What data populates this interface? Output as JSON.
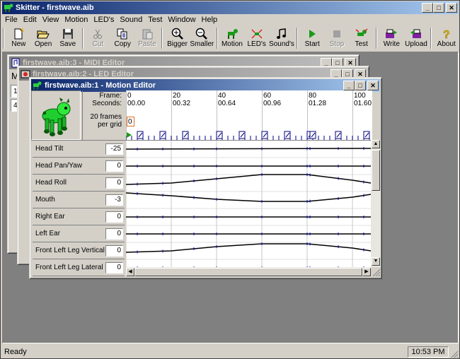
{
  "app": {
    "title": "Skitter - firstwave.aib"
  },
  "menu": [
    "File",
    "Edit",
    "View",
    "Motion",
    "LED's",
    "Sound",
    "Test",
    "Window",
    "Help"
  ],
  "toolbar": {
    "new": "New",
    "open": "Open",
    "save": "Save",
    "cut": "Cut",
    "copy": "Copy",
    "paste": "Paste",
    "bigger": "Bigger",
    "smaller": "Smaller",
    "motion": "Motion",
    "leds": "LED's",
    "sounds": "Sound's",
    "start": "Start",
    "stop": "Stop",
    "test": "Test",
    "write": "Write",
    "upload": "Upload",
    "about": "About"
  },
  "windows": {
    "midi": {
      "title": "firstwave.aib:3 - MIDI Editor",
      "partial": "M",
      "fields": [
        "1",
        "4"
      ]
    },
    "led": {
      "title": "firstwave.aib:2 - LED Editor"
    },
    "motion": {
      "title": "firstwave.aib:1 - Motion Editor",
      "frame_label": "Frame:",
      "seconds_label": "Seconds:",
      "grid_label_1": "20 frames",
      "grid_label_2": "per grid",
      "grid_value": "0",
      "frames": [
        "0",
        "20",
        "40",
        "60",
        "80",
        "100"
      ],
      "seconds": [
        "00.00",
        "00.32",
        "00.64",
        "00.96",
        "01.28",
        "01.60"
      ],
      "tracks": [
        {
          "name": "Head Tilt",
          "value": "-25"
        },
        {
          "name": "Head Pan/Yaw",
          "value": "0"
        },
        {
          "name": "Head Roll",
          "value": "0"
        },
        {
          "name": "Mouth",
          "value": "-3"
        },
        {
          "name": "Right Ear",
          "value": "0"
        },
        {
          "name": "Left Ear",
          "value": "0"
        },
        {
          "name": "Front Left Leg Vertical",
          "value": "0"
        },
        {
          "name": "Front Left Leg Lateral",
          "value": "0"
        }
      ]
    }
  },
  "status": {
    "text": "Ready",
    "clock": "10:53 PM"
  }
}
